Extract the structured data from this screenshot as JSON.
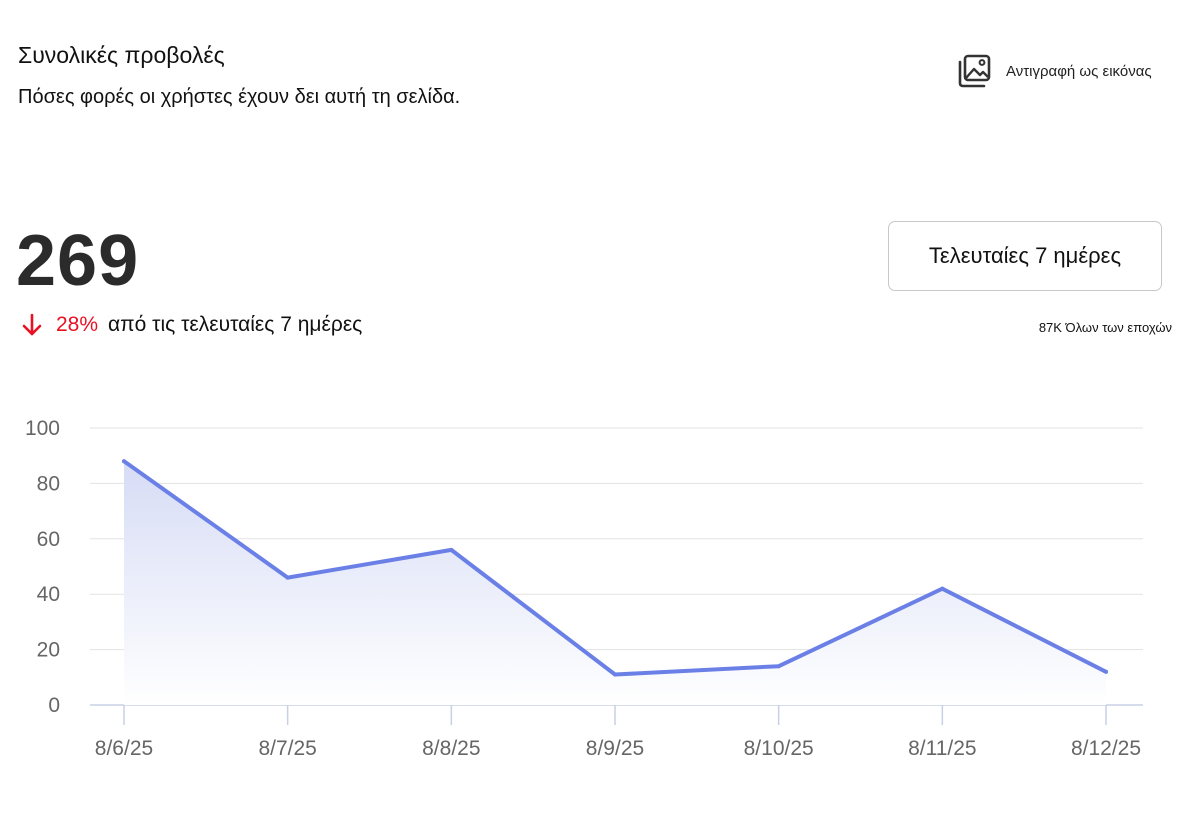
{
  "header": {
    "title": "Συνολικές προβολές",
    "subtitle": "Πόσες φορές οι χρήστες έχουν δει αυτή τη σελίδα."
  },
  "actions": {
    "copy_label": "Αντιγραφή ως εικόνας",
    "copy_icon": "image-icon"
  },
  "summary": {
    "total": "269",
    "change_percent": "28%",
    "change_direction": "down",
    "change_icon": "arrow-down-icon",
    "change_text": "από τις τελευταίες 7 ημέρες",
    "all_time": "87K Όλων των εποχών"
  },
  "range_selector": {
    "label": "Τελευταίες 7 ημέρες"
  },
  "colors": {
    "line": "#6b80e6",
    "area_top": "#d6dcf5",
    "negative": "#e81123",
    "grid": "#e3e3e3"
  },
  "chart_data": {
    "type": "area",
    "categories": [
      "8/6/25",
      "8/7/25",
      "8/8/25",
      "8/9/25",
      "8/10/25",
      "8/11/25",
      "8/12/25"
    ],
    "series": [
      {
        "values": [
          88,
          46,
          56,
          11,
          14,
          42,
          12
        ]
      }
    ],
    "ylim": [
      0,
      100
    ],
    "yticks": [
      0,
      20,
      40,
      60,
      80,
      100
    ],
    "grid": true,
    "legend": "none"
  }
}
